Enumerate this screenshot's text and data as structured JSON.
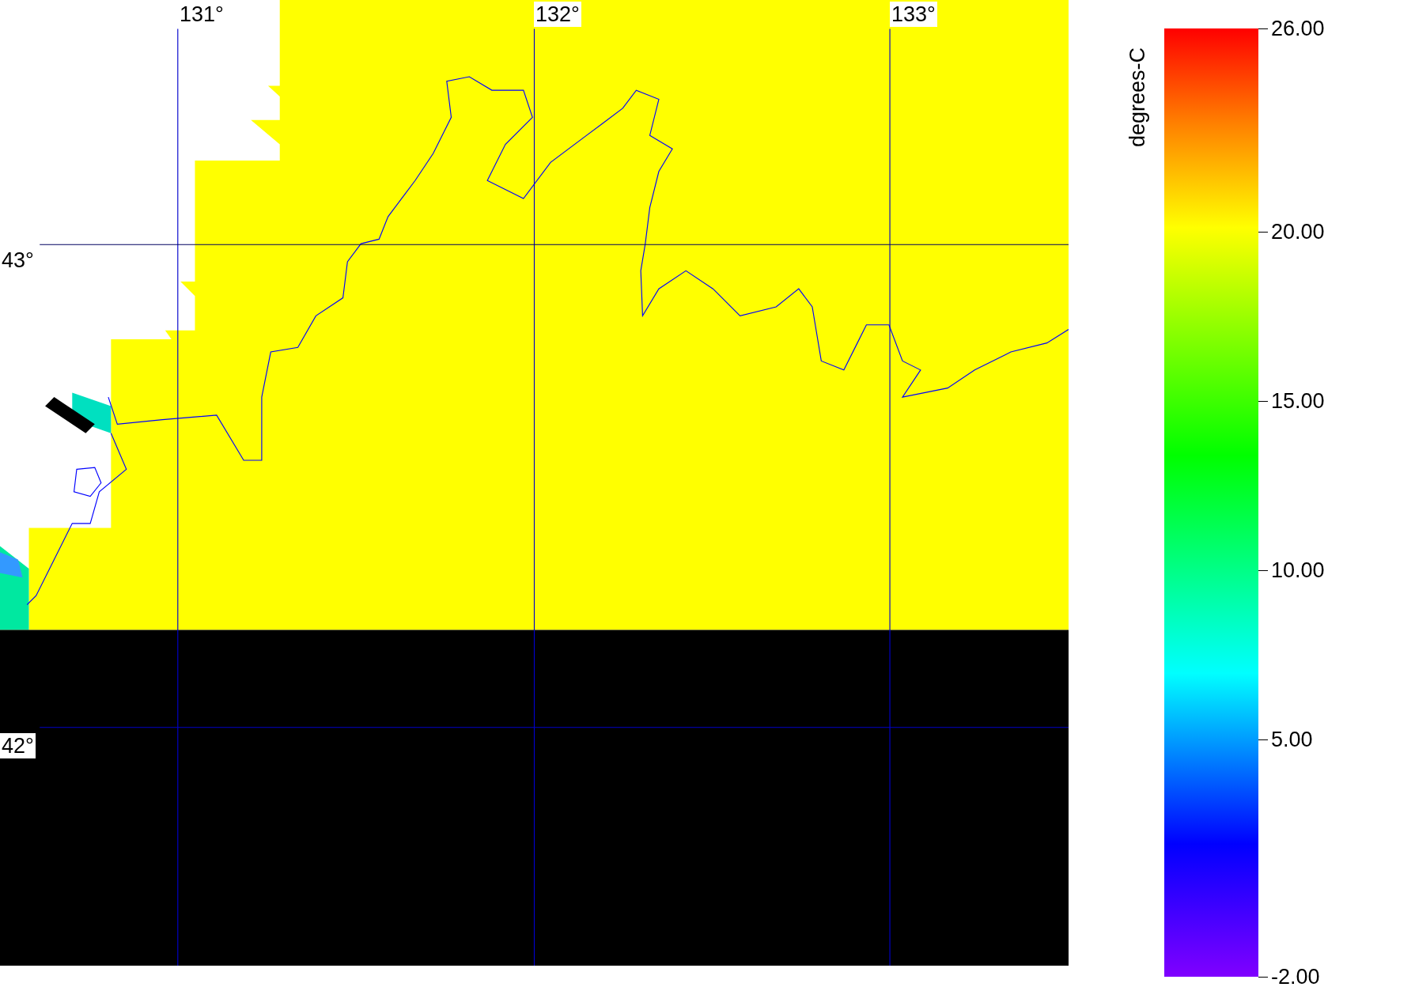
{
  "map": {
    "longitude_labels": [
      "131°",
      "132°",
      "133°"
    ],
    "latitude_labels": [
      "43°",
      "42°"
    ]
  },
  "colorbar": {
    "label": "degrees-C",
    "ticks": [
      "26.00",
      "20.00",
      "15.00",
      "10.00",
      "5.00",
      "-2.00"
    ]
  }
}
